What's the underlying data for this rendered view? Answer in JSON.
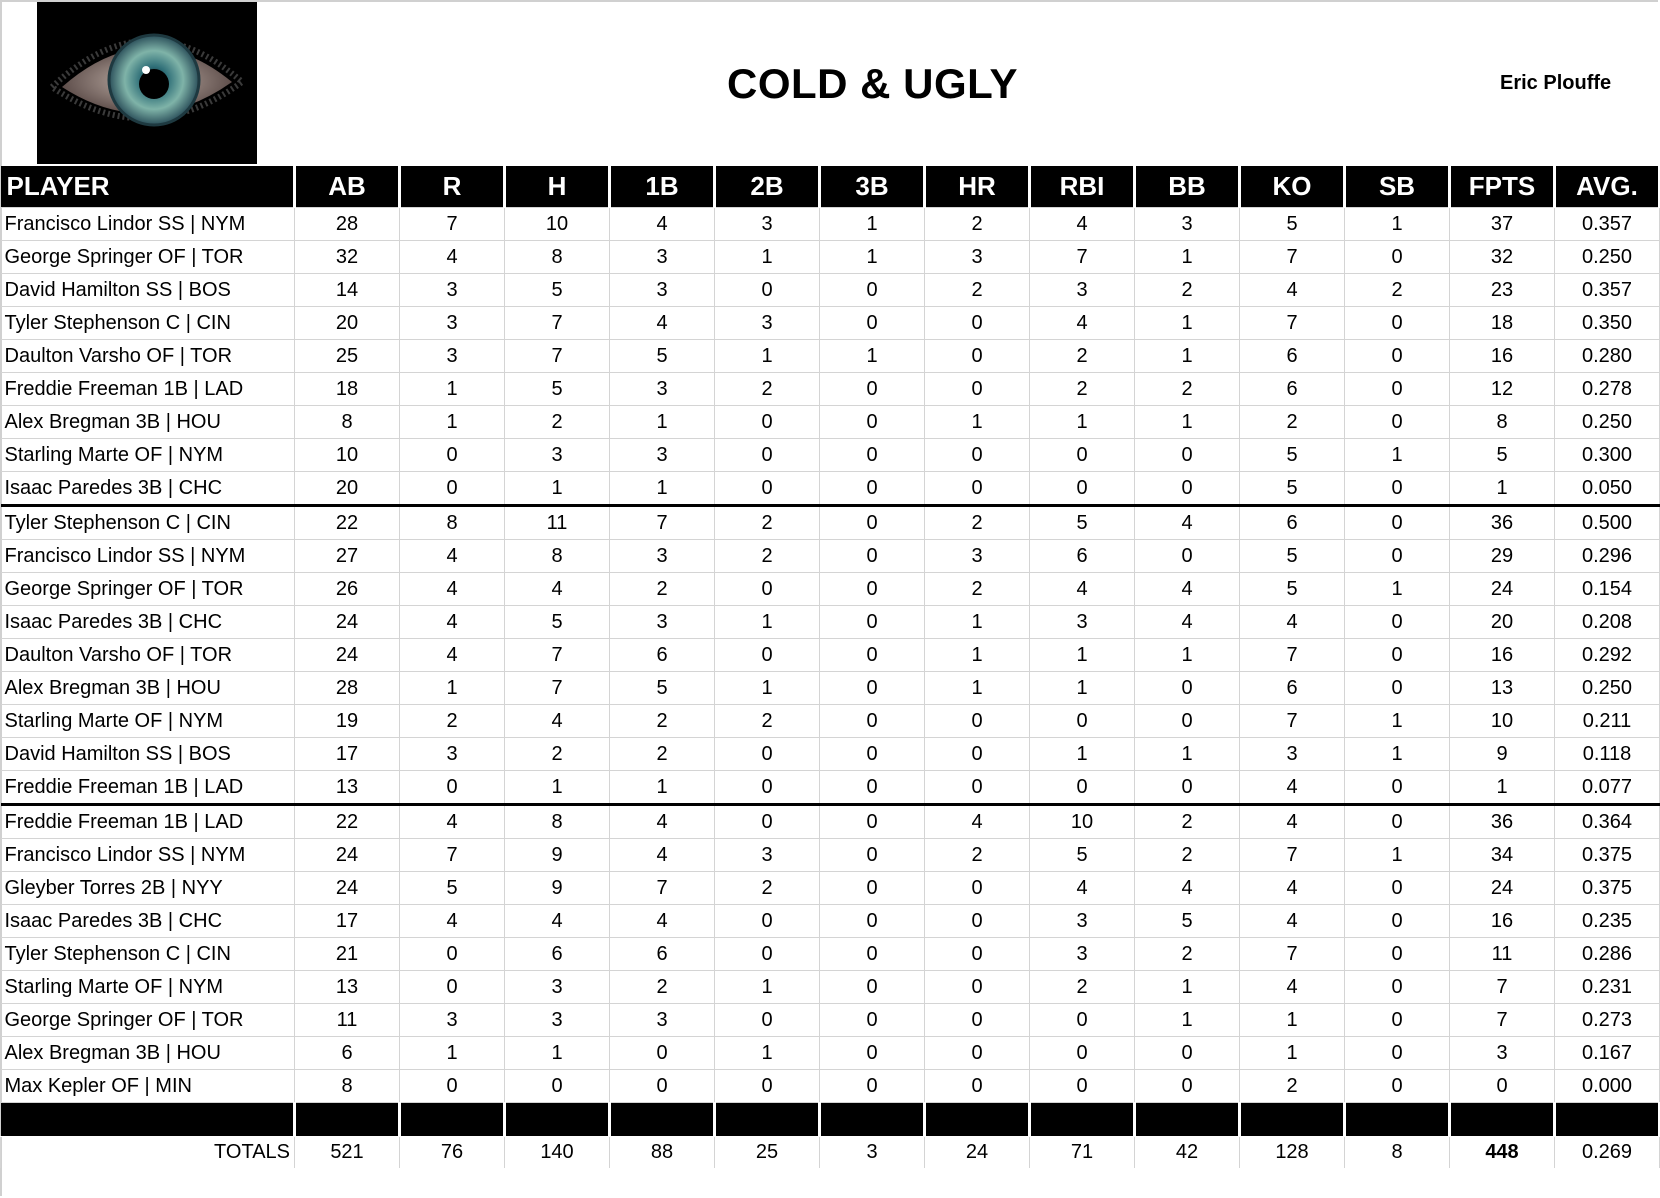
{
  "header": {
    "team_name": "COLD & UGLY",
    "owner": "Eric Plouffe",
    "logo": "eye-logo"
  },
  "table": {
    "columns": [
      "PLAYER",
      "AB",
      "R",
      "H",
      "1B",
      "2B",
      "3B",
      "HR",
      "RBI",
      "BB",
      "KO",
      "SB",
      "FPTS",
      "AVG."
    ],
    "groups": [
      [
        [
          "Francisco Lindor SS | NYM",
          "28",
          "7",
          "10",
          "4",
          "3",
          "1",
          "2",
          "4",
          "3",
          "5",
          "1",
          "37",
          "0.357"
        ],
        [
          "George Springer OF | TOR",
          "32",
          "4",
          "8",
          "3",
          "1",
          "1",
          "3",
          "7",
          "1",
          "7",
          "0",
          "32",
          "0.250"
        ],
        [
          "David Hamilton SS | BOS",
          "14",
          "3",
          "5",
          "3",
          "0",
          "0",
          "2",
          "3",
          "2",
          "4",
          "2",
          "23",
          "0.357"
        ],
        [
          "Tyler Stephenson C | CIN",
          "20",
          "3",
          "7",
          "4",
          "3",
          "0",
          "0",
          "4",
          "1",
          "7",
          "0",
          "18",
          "0.350"
        ],
        [
          "Daulton Varsho OF | TOR",
          "25",
          "3",
          "7",
          "5",
          "1",
          "1",
          "0",
          "2",
          "1",
          "6",
          "0",
          "16",
          "0.280"
        ],
        [
          "Freddie Freeman 1B | LAD",
          "18",
          "1",
          "5",
          "3",
          "2",
          "0",
          "0",
          "2",
          "2",
          "6",
          "0",
          "12",
          "0.278"
        ],
        [
          "Alex Bregman 3B | HOU",
          "8",
          "1",
          "2",
          "1",
          "0",
          "0",
          "1",
          "1",
          "1",
          "2",
          "0",
          "8",
          "0.250"
        ],
        [
          "Starling Marte OF | NYM",
          "10",
          "0",
          "3",
          "3",
          "0",
          "0",
          "0",
          "0",
          "0",
          "5",
          "1",
          "5",
          "0.300"
        ],
        [
          "Isaac Paredes 3B | CHC",
          "20",
          "0",
          "1",
          "1",
          "0",
          "0",
          "0",
          "0",
          "0",
          "5",
          "0",
          "1",
          "0.050"
        ]
      ],
      [
        [
          "Tyler Stephenson C | CIN",
          "22",
          "8",
          "11",
          "7",
          "2",
          "0",
          "2",
          "5",
          "4",
          "6",
          "0",
          "36",
          "0.500"
        ],
        [
          "Francisco Lindor SS | NYM",
          "27",
          "4",
          "8",
          "3",
          "2",
          "0",
          "3",
          "6",
          "0",
          "5",
          "0",
          "29",
          "0.296"
        ],
        [
          "George Springer OF | TOR",
          "26",
          "4",
          "4",
          "2",
          "0",
          "0",
          "2",
          "4",
          "4",
          "5",
          "1",
          "24",
          "0.154"
        ],
        [
          "Isaac Paredes 3B | CHC",
          "24",
          "4",
          "5",
          "3",
          "1",
          "0",
          "1",
          "3",
          "4",
          "4",
          "0",
          "20",
          "0.208"
        ],
        [
          "Daulton Varsho OF | TOR",
          "24",
          "4",
          "7",
          "6",
          "0",
          "0",
          "1",
          "1",
          "1",
          "7",
          "0",
          "16",
          "0.292"
        ],
        [
          "Alex Bregman 3B | HOU",
          "28",
          "1",
          "7",
          "5",
          "1",
          "0",
          "1",
          "1",
          "0",
          "6",
          "0",
          "13",
          "0.250"
        ],
        [
          "Starling Marte OF | NYM",
          "19",
          "2",
          "4",
          "2",
          "2",
          "0",
          "0",
          "0",
          "0",
          "7",
          "1",
          "10",
          "0.211"
        ],
        [
          "David Hamilton SS | BOS",
          "17",
          "3",
          "2",
          "2",
          "0",
          "0",
          "0",
          "1",
          "1",
          "3",
          "1",
          "9",
          "0.118"
        ],
        [
          "Freddie Freeman 1B | LAD",
          "13",
          "0",
          "1",
          "1",
          "0",
          "0",
          "0",
          "0",
          "0",
          "4",
          "0",
          "1",
          "0.077"
        ]
      ],
      [
        [
          "Freddie Freeman 1B | LAD",
          "22",
          "4",
          "8",
          "4",
          "0",
          "0",
          "4",
          "10",
          "2",
          "4",
          "0",
          "36",
          "0.364"
        ],
        [
          "Francisco Lindor SS | NYM",
          "24",
          "7",
          "9",
          "4",
          "3",
          "0",
          "2",
          "5",
          "2",
          "7",
          "1",
          "34",
          "0.375"
        ],
        [
          "Gleyber Torres 2B | NYY",
          "24",
          "5",
          "9",
          "7",
          "2",
          "0",
          "0",
          "4",
          "4",
          "4",
          "0",
          "24",
          "0.375"
        ],
        [
          "Isaac Paredes 3B | CHC",
          "17",
          "4",
          "4",
          "4",
          "0",
          "0",
          "0",
          "3",
          "5",
          "4",
          "0",
          "16",
          "0.235"
        ],
        [
          "Tyler Stephenson C | CIN",
          "21",
          "0",
          "6",
          "6",
          "0",
          "0",
          "0",
          "3",
          "2",
          "7",
          "0",
          "11",
          "0.286"
        ],
        [
          "Starling Marte OF | NYM",
          "13",
          "0",
          "3",
          "2",
          "1",
          "0",
          "0",
          "2",
          "1",
          "4",
          "0",
          "7",
          "0.231"
        ],
        [
          "George Springer OF | TOR",
          "11",
          "3",
          "3",
          "3",
          "0",
          "0",
          "0",
          "0",
          "1",
          "1",
          "0",
          "7",
          "0.273"
        ],
        [
          "Alex Bregman 3B | HOU",
          "6",
          "1",
          "1",
          "0",
          "1",
          "0",
          "0",
          "0",
          "0",
          "1",
          "0",
          "3",
          "0.167"
        ],
        [
          "Max Kepler OF | MIN",
          "8",
          "0",
          "0",
          "0",
          "0",
          "0",
          "0",
          "0",
          "0",
          "2",
          "0",
          "0",
          "0.000"
        ]
      ]
    ],
    "totals": {
      "label": "TOTALS",
      "values": [
        "521",
        "76",
        "140",
        "88",
        "25",
        "3",
        "24",
        "71",
        "42",
        "128",
        "8",
        "448",
        "0.269"
      ],
      "bold_column": "FPTS"
    }
  }
}
